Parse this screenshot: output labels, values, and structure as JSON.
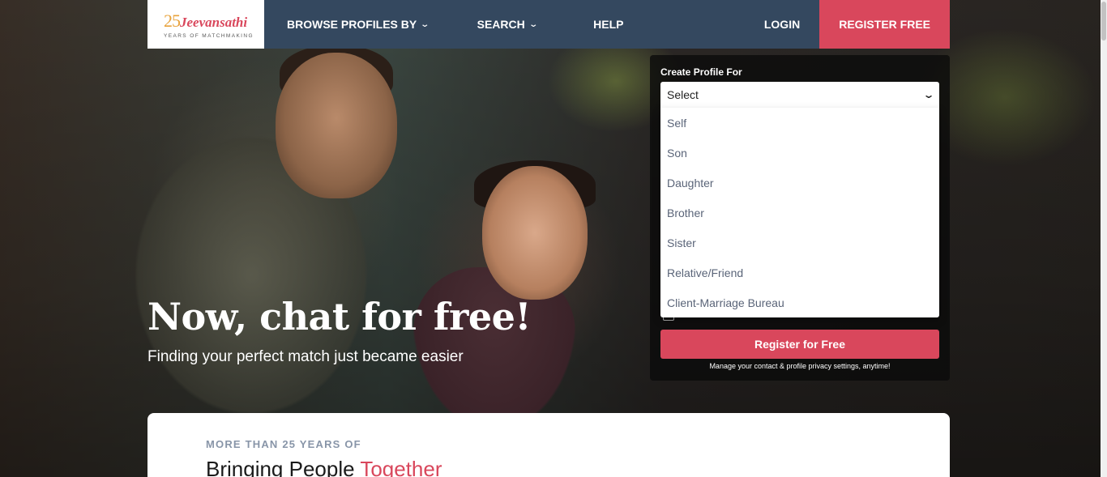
{
  "brand": {
    "logo_number": "25",
    "logo_name": "Jeevansathi",
    "logo_tagline": "YEARS OF MATCHMAKING"
  },
  "nav": {
    "browse_label": "BROWSE PROFILES BY",
    "search_label": "SEARCH",
    "help_label": "HELP",
    "login_label": "LOGIN",
    "register_label": "REGISTER FREE"
  },
  "registration": {
    "create_for_label": "Create Profile For",
    "select_value": "Select",
    "options": [
      "Self",
      "Son",
      "Daughter",
      "Brother",
      "Sister",
      "Relative/Friend",
      "Client-Marriage Bureau"
    ],
    "register_button": "Register for Free",
    "privacy_note": "Manage your contact & profile privacy settings, anytime!"
  },
  "hero": {
    "title": "Now, chat for free!",
    "subtitle": "Finding your perfect match just became easier"
  },
  "about": {
    "kicker": "MORE THAN 25 YEARS OF",
    "heading_main": "Bringing People ",
    "heading_accent": "Together"
  },
  "colors": {
    "nav_bg": "#34485f",
    "accent": "#d9475c",
    "logo_number": "#e8a33d"
  }
}
